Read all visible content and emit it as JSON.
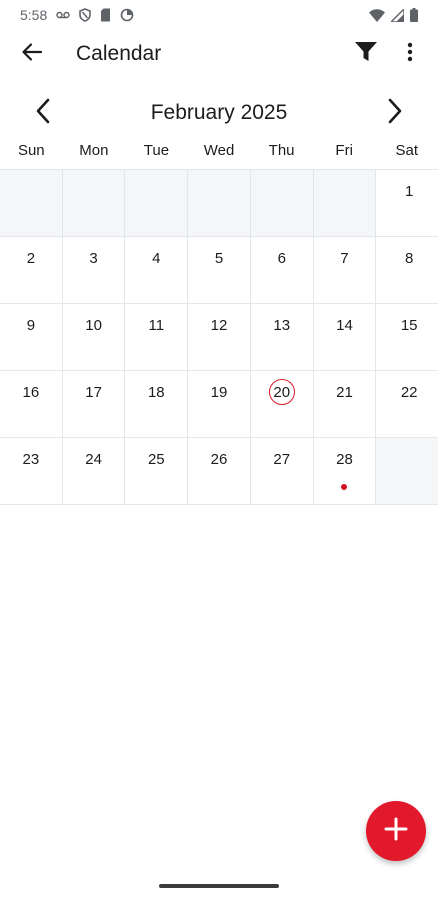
{
  "status_bar": {
    "time": "5:58",
    "left_icons": [
      "voicemail-icon",
      "vpn-shield-icon",
      "sim-card-icon",
      "sync-icon"
    ],
    "right_icons": [
      "wifi-icon",
      "cell-signal-icon",
      "battery-icon"
    ]
  },
  "app_bar": {
    "title": "Calendar",
    "back_icon": "arrow-back-icon",
    "filter_icon": "filter-icon",
    "more_icon": "more-vert-icon"
  },
  "month_nav": {
    "label": "February 2025",
    "prev_icon": "chevron-left-icon",
    "next_icon": "chevron-right-icon"
  },
  "weekdays": [
    "Sun",
    "Mon",
    "Tue",
    "Wed",
    "Thu",
    "Fri",
    "Sat"
  ],
  "weeks": [
    [
      null,
      null,
      null,
      null,
      null,
      null,
      "1"
    ],
    [
      "2",
      "3",
      "4",
      "5",
      "6",
      "7",
      "8"
    ],
    [
      "9",
      "10",
      "11",
      "12",
      "13",
      "14",
      "15"
    ],
    [
      "16",
      "17",
      "18",
      "19",
      "20",
      "21",
      "22"
    ],
    [
      "23",
      "24",
      "25",
      "26",
      "27",
      "28",
      null
    ]
  ],
  "today": "20",
  "event_days": [
    "28"
  ],
  "colors": {
    "accent": "#e2182b",
    "today_ring": "#d81e2c",
    "event_dot": "#d0101e",
    "empty_cell": "#f4f6f8",
    "grid_line": "#e3e6ea"
  },
  "fab": {
    "icon": "add-icon"
  }
}
